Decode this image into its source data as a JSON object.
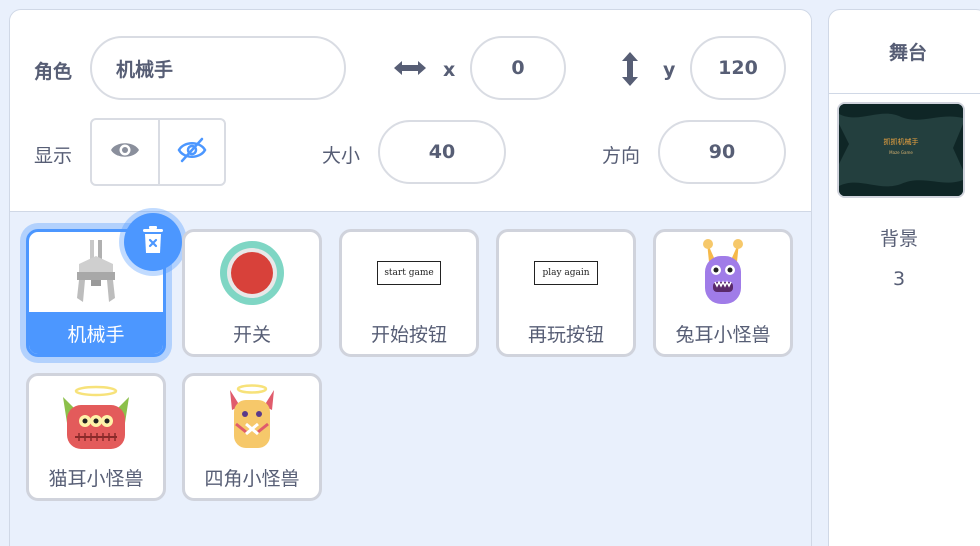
{
  "sprite_info": {
    "sprite_label": "角色",
    "sprite_name": "机械手",
    "x_label": "x",
    "x_value": "0",
    "y_label": "y",
    "y_value": "120",
    "show_label": "显示",
    "size_label": "大小",
    "size_value": "40",
    "direction_label": "方向",
    "direction_value": "90"
  },
  "sprites": [
    {
      "name": "机械手",
      "selected": true,
      "icon": "robot-claw"
    },
    {
      "name": "开关",
      "icon": "red-switch"
    },
    {
      "name": "开始按钮",
      "icon": "start-game-button",
      "thumb_text": "start game"
    },
    {
      "name": "再玩按钮",
      "icon": "play-again-button",
      "thumb_text": "play again"
    },
    {
      "name": "兔耳小怪兽",
      "icon": "purple-monster"
    },
    {
      "name": "猫耳小怪兽",
      "icon": "red-monster"
    },
    {
      "name": "四角小怪兽",
      "icon": "yellow-monster"
    }
  ],
  "stage": {
    "title": "舞台",
    "thumb_title": "抓抓机械手",
    "thumb_subtitle": "Maze Game",
    "backdrops_label": "背景",
    "backdrops_count": "3"
  },
  "colors": {
    "accent": "#4c97ff",
    "text": "#575e75",
    "pane_bg": "#e9f0fc"
  }
}
